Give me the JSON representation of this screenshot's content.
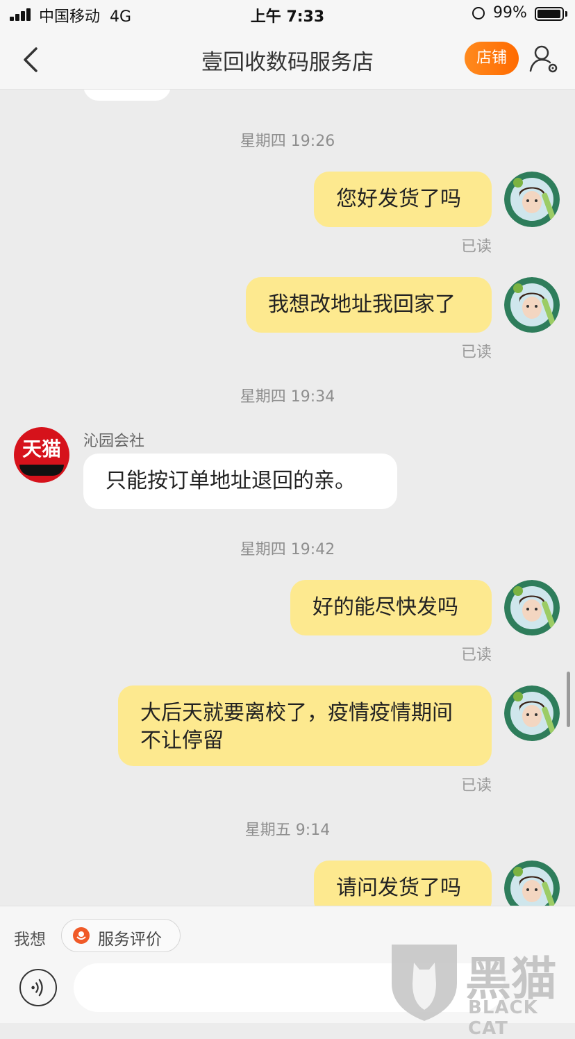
{
  "status_bar": {
    "carrier": "中国移动",
    "network": "4G",
    "time": "上午 7:33",
    "battery": "99%"
  },
  "header": {
    "title": "壹回收数码服务店",
    "store_button": "店铺",
    "icons": {
      "back": "chevron-left-icon",
      "profile": "person-settings-icon"
    }
  },
  "chat": {
    "timestamps": [
      "星期四 19:26",
      "星期四 19:34",
      "星期四 19:42",
      "星期五 9:14"
    ],
    "messages": [
      {
        "from": "me",
        "text": "您好发货了吗",
        "status": "已读"
      },
      {
        "from": "me",
        "text": "我想改地址我回家了",
        "status": "已读"
      },
      {
        "from": "them",
        "sender": "沁园会社",
        "avatar_text": "天猫",
        "text": "只能按订单地址退回的亲。"
      },
      {
        "from": "me",
        "text": "好的能尽快发吗",
        "status": "已读"
      },
      {
        "from": "me",
        "text": "大后天就要离校了，疫情疫情期间不让停留",
        "status": "已读"
      },
      {
        "from": "me",
        "text": "请问发货了吗"
      }
    ]
  },
  "bottom": {
    "want_label": "我想",
    "service_button": "服务评价",
    "icons": {
      "voice": "voice-icon",
      "service": "flower-icon"
    }
  },
  "watermark": {
    "cn": "黑猫",
    "en": "BLACK CAT"
  },
  "colors": {
    "my_bubble": "#fde98f",
    "their_bubble": "#ffffff",
    "accent": "#ff6a00",
    "tmall": "#d6121b"
  }
}
